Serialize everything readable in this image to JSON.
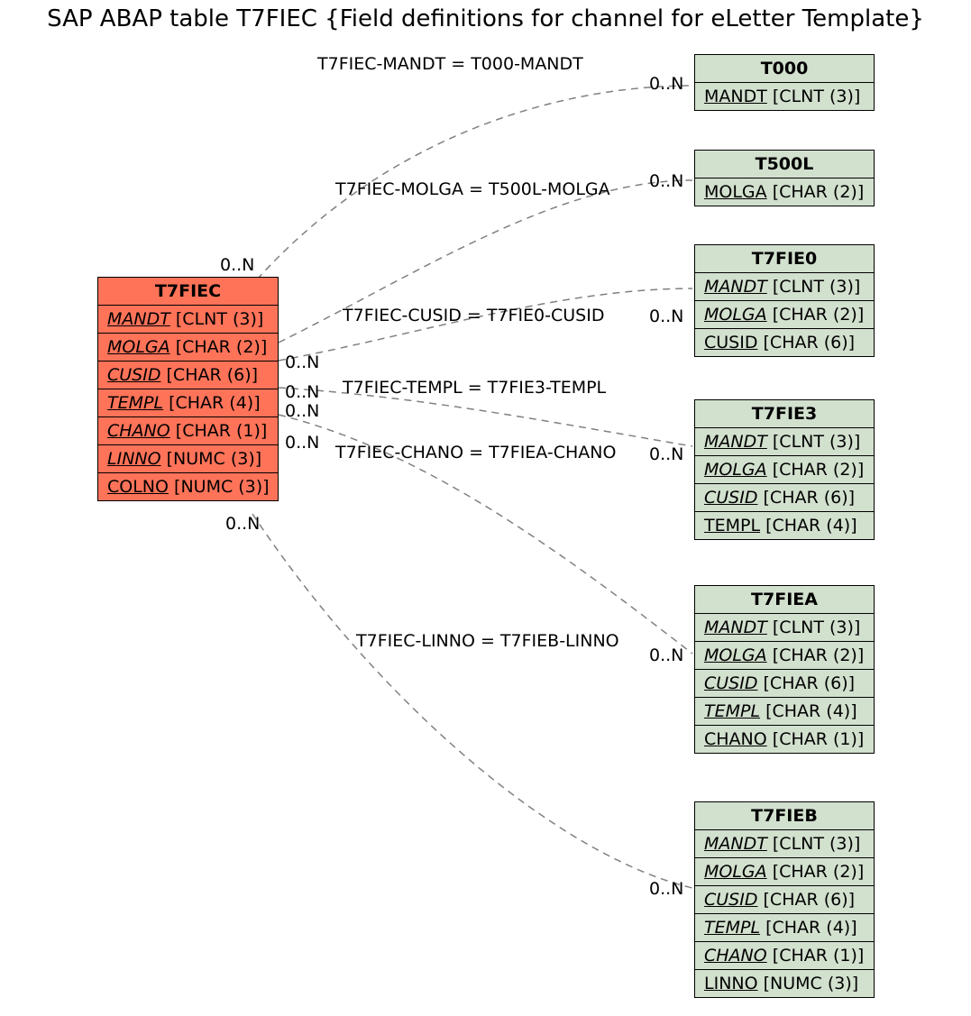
{
  "title": "SAP ABAP table T7FIEC {Field definitions for channel for eLetter Template}",
  "mainTable": {
    "name": "T7FIEC",
    "fields": [
      {
        "name": "MANDT",
        "type": "[CLNT (3)]",
        "key": true
      },
      {
        "name": "MOLGA",
        "type": "[CHAR (2)]",
        "key": true
      },
      {
        "name": "CUSID",
        "type": "[CHAR (6)]",
        "key": true
      },
      {
        "name": "TEMPL",
        "type": "[CHAR (4)]",
        "key": true
      },
      {
        "name": "CHANO",
        "type": "[CHAR (1)]",
        "key": true
      },
      {
        "name": "LINNO",
        "type": "[NUMC (3)]",
        "key": true
      },
      {
        "name": "COLNO",
        "type": "[NUMC (3)]",
        "key": false
      }
    ]
  },
  "refTables": [
    {
      "name": "T000",
      "fields": [
        {
          "name": "MANDT",
          "type": "[CLNT (3)]",
          "key": false
        }
      ]
    },
    {
      "name": "T500L",
      "fields": [
        {
          "name": "MOLGA",
          "type": "[CHAR (2)]",
          "key": false
        }
      ]
    },
    {
      "name": "T7FIE0",
      "fields": [
        {
          "name": "MANDT",
          "type": "[CLNT (3)]",
          "key": true
        },
        {
          "name": "MOLGA",
          "type": "[CHAR (2)]",
          "key": true
        },
        {
          "name": "CUSID",
          "type": "[CHAR (6)]",
          "key": false
        }
      ]
    },
    {
      "name": "T7FIE3",
      "fields": [
        {
          "name": "MANDT",
          "type": "[CLNT (3)]",
          "key": true
        },
        {
          "name": "MOLGA",
          "type": "[CHAR (2)]",
          "key": true
        },
        {
          "name": "CUSID",
          "type": "[CHAR (6)]",
          "key": true
        },
        {
          "name": "TEMPL",
          "type": "[CHAR (4)]",
          "key": false
        }
      ]
    },
    {
      "name": "T7FIEA",
      "fields": [
        {
          "name": "MANDT",
          "type": "[CLNT (3)]",
          "key": true
        },
        {
          "name": "MOLGA",
          "type": "[CHAR (2)]",
          "key": true
        },
        {
          "name": "CUSID",
          "type": "[CHAR (6)]",
          "key": true
        },
        {
          "name": "TEMPL",
          "type": "[CHAR (4)]",
          "key": true
        },
        {
          "name": "CHANO",
          "type": "[CHAR (1)]",
          "key": false
        }
      ]
    },
    {
      "name": "T7FIEB",
      "fields": [
        {
          "name": "MANDT",
          "type": "[CLNT (3)]",
          "key": true
        },
        {
          "name": "MOLGA",
          "type": "[CHAR (2)]",
          "key": true
        },
        {
          "name": "CUSID",
          "type": "[CHAR (6)]",
          "key": true
        },
        {
          "name": "TEMPL",
          "type": "[CHAR (4)]",
          "key": true
        },
        {
          "name": "CHANO",
          "type": "[CHAR (1)]",
          "key": true
        },
        {
          "name": "LINNO",
          "type": "[NUMC (3)]",
          "key": false
        }
      ]
    }
  ],
  "relations": [
    {
      "label": "T7FIEC-MANDT = T000-MANDT"
    },
    {
      "label": "T7FIEC-MOLGA = T500L-MOLGA"
    },
    {
      "label": "T7FIEC-CUSID = T7FIE0-CUSID"
    },
    {
      "label": "T7FIEC-TEMPL = T7FIE3-TEMPL"
    },
    {
      "label": "T7FIEC-CHANO = T7FIEA-CHANO"
    },
    {
      "label": "T7FIEC-LINNO = T7FIEB-LINNO"
    }
  ],
  "card": {
    "leftMain": "0..N",
    "right": [
      "0..N",
      "0..N",
      "0..N",
      "0..N",
      "0..N",
      "0..N"
    ],
    "nearMain": [
      "0..N",
      "0..N",
      "0..N",
      "0..N",
      "0..N",
      "0..N"
    ]
  }
}
